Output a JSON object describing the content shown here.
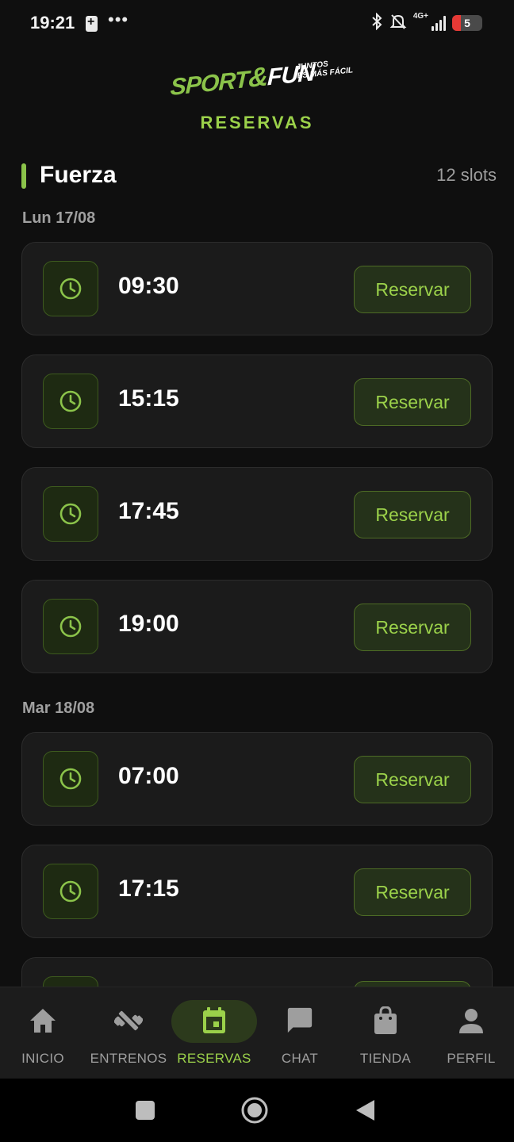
{
  "status_bar": {
    "time": "19:21",
    "more": "•••",
    "network": "4G+",
    "battery": "5"
  },
  "header": {
    "logo": {
      "part1": "SPORT",
      "amp": "&",
      "part2": "FUN",
      "tagline_line1": "JUNTOS",
      "tagline_line2": "ES MÁS FÁCIL"
    },
    "title": "RESERVAS"
  },
  "section": {
    "title": "Fuerza",
    "count": "12 slots"
  },
  "days": [
    {
      "label": "Lun 17/08",
      "slots": [
        "09:30",
        "15:15",
        "17:45",
        "19:00"
      ]
    },
    {
      "label": "Mar 18/08",
      "slots": [
        "07:00",
        "17:15"
      ]
    }
  ],
  "reserve_label": "Reservar",
  "bottom_nav": [
    {
      "label": "INICIO",
      "icon": "home-icon"
    },
    {
      "label": "ENTRENOS",
      "icon": "dumbbell-icon"
    },
    {
      "label": "RESERVAS",
      "icon": "calendar-icon",
      "active": true
    },
    {
      "label": "CHAT",
      "icon": "chat-icon"
    },
    {
      "label": "TIENDA",
      "icon": "shopping-bag-icon"
    },
    {
      "label": "PERFIL",
      "icon": "person-icon"
    }
  ],
  "colors": {
    "accent": "#8bc34a",
    "accent_text": "#9bd14a",
    "background": "#0f0f0f",
    "card": "#1b1b1b"
  }
}
